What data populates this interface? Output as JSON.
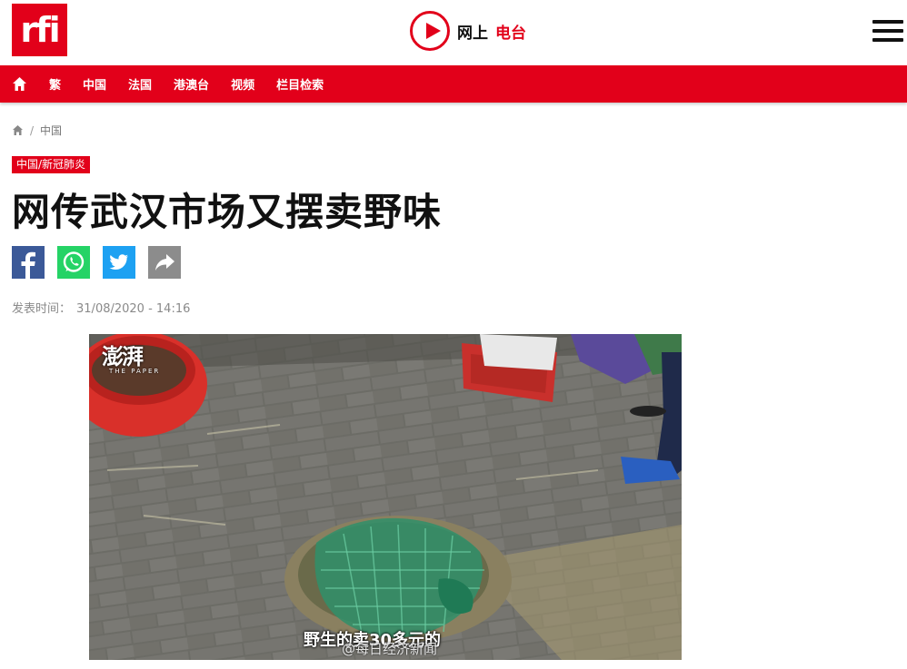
{
  "header": {
    "logo_text": "rfi",
    "radio_label": "网上",
    "radio_accent": "电台",
    "menu_icon": "hamburger-menu-icon"
  },
  "nav": {
    "home_icon": "home-icon",
    "items": [
      "繁",
      "中国",
      "法国",
      "港澳台",
      "视频",
      "栏目检索"
    ]
  },
  "breadcrumb": {
    "home_icon": "home-icon",
    "separator": "/",
    "current": "中国"
  },
  "article": {
    "tag": "中国/新冠肺炎",
    "title": "网传武汉市场又摆卖野味",
    "share_buttons": [
      "facebook-icon",
      "whatsapp-icon",
      "twitter-icon",
      "share-icon"
    ],
    "date_label": "发表时间：",
    "date_value": "31/08/2020 - 14:16"
  },
  "photo": {
    "watermark": "澎湃",
    "watermark_sub": "THE PAPER",
    "subtitle": "野生的卖30多元的",
    "weibo_credit": "@每日经济新闻"
  },
  "colors": {
    "brand_red": "#e2001a",
    "facebook": "#3b5998",
    "whatsapp": "#25d366",
    "twitter": "#1da1f2",
    "share": "#8c8c8c"
  }
}
